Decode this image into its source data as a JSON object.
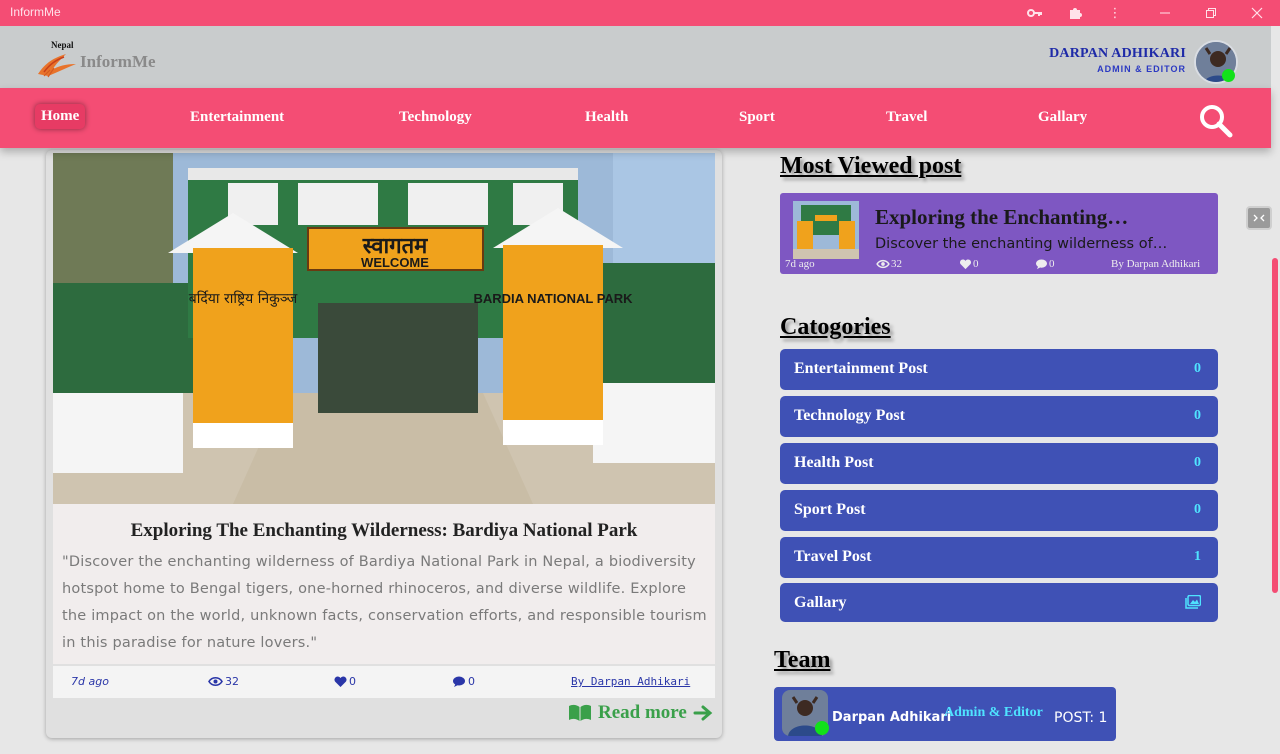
{
  "window": {
    "title": "InformMe"
  },
  "header": {
    "logo_small": "Nepal",
    "logo_brand": "InformMe",
    "user_name": "DARPAN ADHIKARI",
    "user_role": "ADMIN & EDITOR"
  },
  "nav": {
    "items": [
      "Home",
      "Entertainment",
      "Technology",
      "Health",
      "Sport",
      "Travel",
      "Gallary"
    ]
  },
  "post": {
    "title": "Exploring The Enchanting Wilderness: Bardiya National Park",
    "excerpt": "\"Discover the enchanting wilderness of Bardiya National Park in Nepal, a biodiversity hotspot home to Bengal tigers, one-horned rhinoceros, and diverse wildlife. Explore the impact on the world, unknown facts, conservation efforts, and responsible tourism in this paradise for nature lovers.\"",
    "time": "7d ago",
    "views": "32",
    "likes": "0",
    "comments": "0",
    "author": "By Darpan Adhikari",
    "read_more": "Read more",
    "sign_devanagari": "स्वागतम",
    "sign_welcome": "WELCOME",
    "sign_left": "बर्दिया राष्ट्रिय निकुञ्ज",
    "sign_right": "BARDIA NATIONAL PARK"
  },
  "most_viewed": {
    "heading": "Most Viewed post",
    "title": "Exploring the Enchanting…",
    "excerpt": "Discover the enchanting wilderness of…",
    "time": "7d ago",
    "views": "32",
    "likes": "0",
    "comments": "0",
    "author": "By Darpan Adhikari"
  },
  "categories": {
    "heading": "Catogories",
    "items": [
      {
        "label": "Entertainment Post",
        "count": "0"
      },
      {
        "label": "Technology Post",
        "count": "0"
      },
      {
        "label": "Health Post",
        "count": "0"
      },
      {
        "label": "Sport Post",
        "count": "0"
      },
      {
        "label": "Travel Post",
        "count": "1"
      },
      {
        "label": "Gallary",
        "icon": "gallery-icon"
      }
    ]
  },
  "team": {
    "heading": "Team",
    "name": "Darpan Adhikari",
    "role": "Admin & Editor",
    "posts": "POST: 1"
  },
  "colors": {
    "brand_pink": "#f44d74",
    "category_blue": "#3f51b5",
    "most_viewed_purple": "#7e57c2",
    "count_cyan": "#4fe3ff",
    "read_more_green": "#3aa04a",
    "online_green": "#12e11a"
  }
}
